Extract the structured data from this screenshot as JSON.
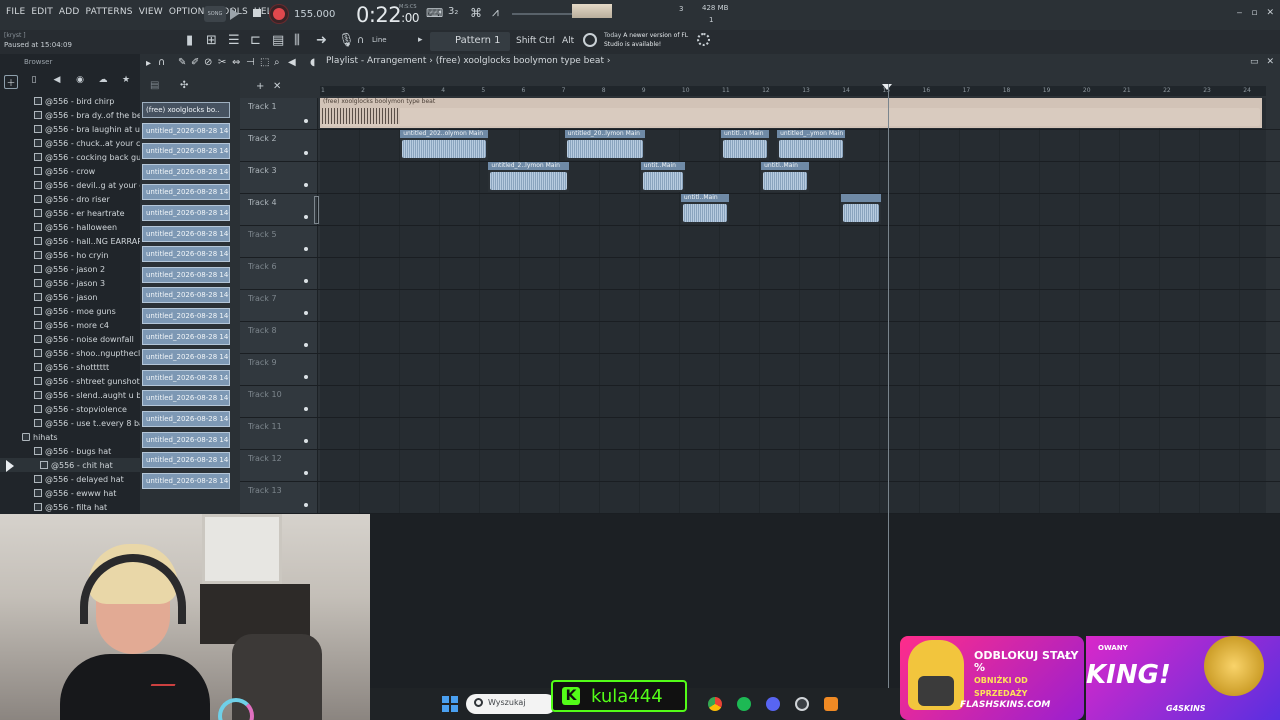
{
  "menu": [
    "FILE",
    "EDIT",
    "ADD",
    "PATTERNS",
    "VIEW",
    "OPTIONS",
    "TOOLS",
    "HELP"
  ],
  "transport": {
    "song_mode": "SONG",
    "tempo": "155.000",
    "time_unit": "M:S:CS",
    "time_main": "0:22",
    "time_sub": ":00",
    "cpu_a": "3",
    "cpu_b": "1",
    "mem": "428 MB",
    "cpu_icon": "3₂"
  },
  "toolbar": {
    "user": "[kryst  ]",
    "status": "Paused at 15:04:09",
    "snap_label": "Line",
    "pattern": "Pattern 1",
    "keys": [
      "Shift",
      "Ctrl",
      "Alt"
    ],
    "news_today": "Today",
    "news_text": "A newer version of FL Studio is available!"
  },
  "browser": {
    "title": "Browser",
    "items": [
      {
        "label": "@556 - bird chirp",
        "kind": "file"
      },
      {
        "label": "@556 - bra dy..of the beat",
        "kind": "file"
      },
      {
        "label": "@556 - bra laughin at u",
        "kind": "file"
      },
      {
        "label": "@556 - chuck..at your cut",
        "kind": "file"
      },
      {
        "label": "@556 - cocking back gun",
        "kind": "file"
      },
      {
        "label": "@556 - crow",
        "kind": "file"
      },
      {
        "label": "@556 - devil..g at your cut",
        "kind": "file"
      },
      {
        "label": "@556 - dro riser",
        "kind": "file"
      },
      {
        "label": "@556 - er heartrate",
        "kind": "file"
      },
      {
        "label": "@556 - halloween",
        "kind": "file"
      },
      {
        "label": "@556 - hall..NG EARRAPE)",
        "kind": "file"
      },
      {
        "label": "@556 - ho cryin",
        "kind": "file"
      },
      {
        "label": "@556 - jason 2",
        "kind": "file"
      },
      {
        "label": "@556 - jason 3",
        "kind": "file"
      },
      {
        "label": "@556 - jason",
        "kind": "file"
      },
      {
        "label": "@556 - moe guns",
        "kind": "file"
      },
      {
        "label": "@556 - more c4",
        "kind": "file"
      },
      {
        "label": "@556 - noise downfall",
        "kind": "file"
      },
      {
        "label": "@556 - shoo..nguptheclub",
        "kind": "file"
      },
      {
        "label": "@556 - shotttttt",
        "kind": "file"
      },
      {
        "label": "@556 - shtreet gunshot",
        "kind": "file"
      },
      {
        "label": "@556 - slend..aught u bro",
        "kind": "file"
      },
      {
        "label": "@556 - stopviolence",
        "kind": "file"
      },
      {
        "label": "@556 - use t..every 8 bars",
        "kind": "file"
      },
      {
        "label": "hihats",
        "kind": "folder"
      },
      {
        "label": "@556 - bugs hat",
        "kind": "file"
      },
      {
        "label": "@556 - chit hat",
        "kind": "sub"
      },
      {
        "label": "@556 - delayed hat",
        "kind": "file"
      },
      {
        "label": "@556 - ewww hat",
        "kind": "file"
      },
      {
        "label": "@556 - filta hat",
        "kind": "file"
      }
    ]
  },
  "picker": {
    "first": "(free) xoolglocks bo..",
    "clip_label": "untitled_2026-08-28 14-",
    "count": 19
  },
  "playlist": {
    "title": "Playlist - Arrangement",
    "arrangement": "(free) xoolglocks boolymon type beat",
    "ruler": [
      "1",
      "2",
      "3",
      "4",
      "5",
      "6",
      "7",
      "8",
      "9",
      "10",
      "11",
      "12",
      "13",
      "14",
      "15",
      "16",
      "17",
      "18",
      "19",
      "20",
      "21",
      "22",
      "23",
      "24"
    ],
    "tracks": [
      "Track 1",
      "Track 2",
      "Track 3",
      "Track 4",
      "Track 5",
      "Track 6",
      "Track 7",
      "Track 8",
      "Track 9",
      "Track 10",
      "Track 11",
      "Track 12",
      "Track 13"
    ],
    "clips": [
      {
        "track": 0,
        "label": "(free) xoolglocks boolymon type beat",
        "style": "top",
        "start": 1,
        "end": 24.5
      },
      {
        "track": 1,
        "label": "untitled_202..olymon Main",
        "start": 3,
        "end": 5.2
      },
      {
        "track": 1,
        "label": "untitled_20..lymon Main",
        "start": 7.1,
        "end": 9.1
      },
      {
        "track": 1,
        "label": "untitl..n Main",
        "start": 11,
        "end": 12.2
      },
      {
        "track": 1,
        "label": "untitled_..ymon Main",
        "start": 12.4,
        "end": 14.1
      },
      {
        "track": 2,
        "label": "untitled_2..lymon Main",
        "start": 5.2,
        "end": 7.2
      },
      {
        "track": 2,
        "label": "untit..Main",
        "start": 9,
        "end": 10.1
      },
      {
        "track": 2,
        "label": "untitl..Main",
        "start": 12,
        "end": 13.2
      },
      {
        "track": 3,
        "label": "untitl..Main",
        "start": 10,
        "end": 11.2
      },
      {
        "track": 3,
        "label": "",
        "start": 14,
        "end": 15
      }
    ]
  },
  "taskbar": {
    "search_placeholder": "Wyszukaj"
  },
  "overlay": {
    "kick_name": "kula444",
    "kick_badge": "K",
    "ad_line1": "ODBLOKUJ STAŁY %",
    "ad_line2": "OBNIŻKI OD SPRZEDAŻY",
    "ad_brand": "FLASHSKINS.COM",
    "ad_right_small": "OWANY",
    "ad_right_big": "KING!",
    "ad_right_brand": "G4SKINS"
  }
}
